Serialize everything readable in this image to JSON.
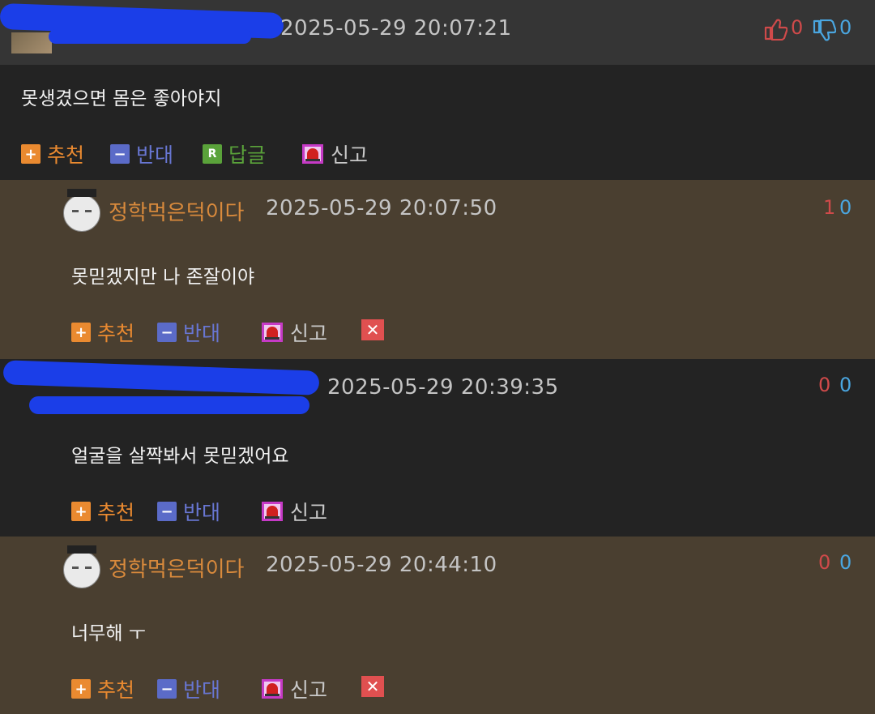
{
  "comments": [
    {
      "date": "2025-05-29 20:07:21",
      "text": "못생겼으면 몸은 좋아야지",
      "up": "0",
      "down": "0",
      "actions": {
        "up": "추천",
        "down": "반대",
        "reply": "답글",
        "report": "신고"
      }
    },
    {
      "nick": "정학먹은덕이다",
      "date": "2025-05-29 20:07:50",
      "text": "못믿겠지만 나 존잘이야",
      "up": "1",
      "down": "0",
      "actions": {
        "up": "추천",
        "down": "반대",
        "report": "신고"
      }
    },
    {
      "date": "2025-05-29 20:39:35",
      "text": "얼굴을 살짝봐서 못믿겠어요",
      "up": "0",
      "down": "0",
      "actions": {
        "up": "추천",
        "down": "반대",
        "report": "신고"
      }
    },
    {
      "nick": "정학먹은덕이다",
      "date": "2025-05-29 20:44:10",
      "text": "너무해 ㅜ",
      "up": "0",
      "down": "0",
      "actions": {
        "up": "추천",
        "down": "반대",
        "report": "신고"
      }
    }
  ],
  "icons": {
    "up": "plus-icon",
    "down": "minus-icon",
    "reply": "reply-icon",
    "report": "siren-icon",
    "delete": "close-icon",
    "thumbs_up": "thumbs-up-icon",
    "thumbs_down": "thumbs-down-icon"
  },
  "colors": {
    "nick": "#d98a3c",
    "up": "#ea8a30",
    "down": "#5b6bc8",
    "reply": "#5aa23a",
    "report": "#c63ac6",
    "delete": "#e05050",
    "reply_bg": "#4a3f30",
    "base_bg": "#232323"
  }
}
